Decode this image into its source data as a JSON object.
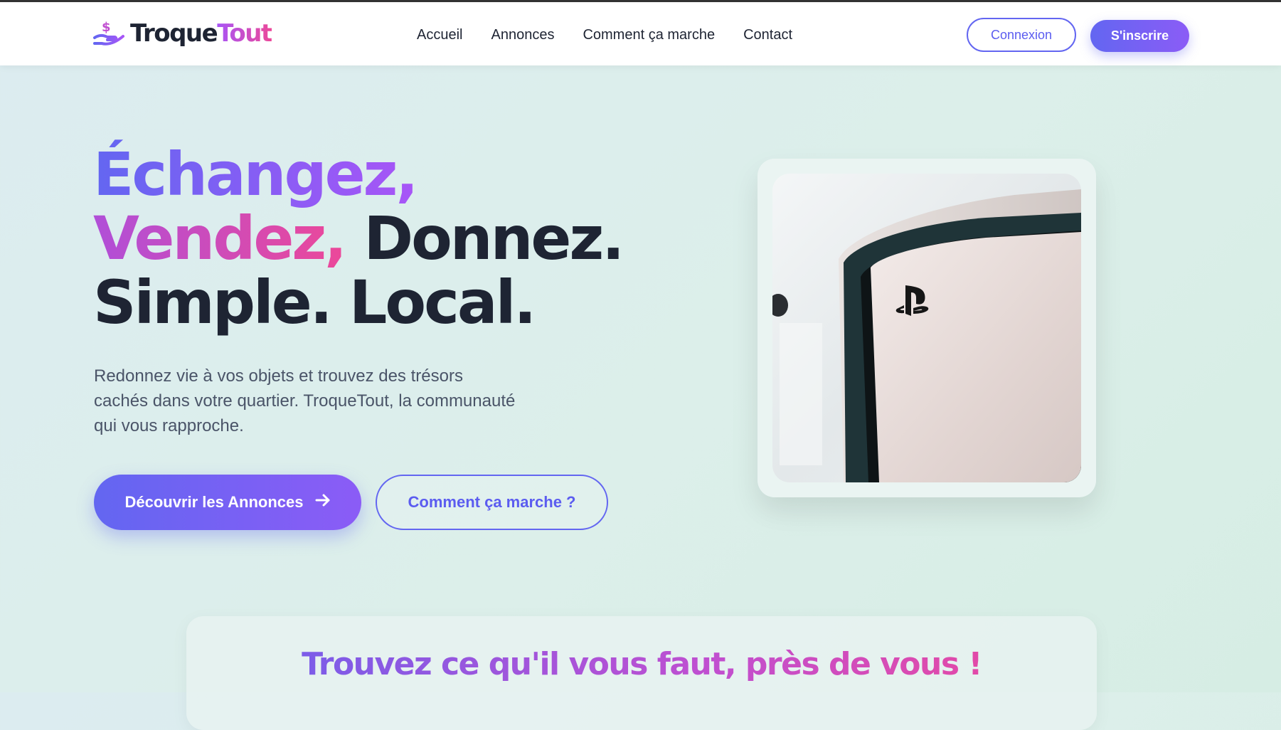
{
  "brand": {
    "name_part1": "Troque",
    "name_part2": "Tout",
    "icon": "hand-coin-icon"
  },
  "nav": {
    "links": [
      "Accueil",
      "Annonces",
      "Comment ça marche",
      "Contact"
    ],
    "login_label": "Connexion",
    "signup_label": "S'inscrire"
  },
  "hero": {
    "title_line1": "Échangez,",
    "title_line2_colored": "Vendez,",
    "title_line2_rest": " Donnez.",
    "title_line3": "Simple. Local.",
    "description": "Redonnez vie à vos objets et trouvez des trésors cachés dans votre quartier. TroqueTout, la communauté qui vous rapproche.",
    "primary_cta": "Découvrir les Annonces",
    "primary_cta_icon": "arrow-right-icon",
    "secondary_cta": "Comment ça marche ?",
    "image_subject": "console-image"
  },
  "search_section": {
    "title": "Trouvez ce qu'il vous faut, près de vous !"
  },
  "colors": {
    "accent": "#6366f1",
    "accent_secondary": "#8b5cf6",
    "pink": "#ec4899",
    "text_dark": "#1e2433"
  }
}
